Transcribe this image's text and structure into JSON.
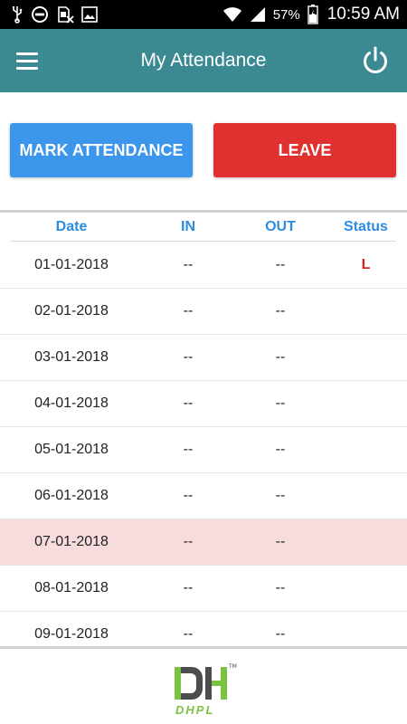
{
  "status_bar": {
    "battery": "57%",
    "time": "10:59 AM",
    "icons": [
      "usb-icon",
      "do-not-disturb-icon",
      "no-sim-icon",
      "image-icon",
      "wifi-icon",
      "signal-icon",
      "battery-icon"
    ]
  },
  "app_bar": {
    "title": "My Attendance",
    "icons": [
      "menu-icon",
      "power-icon"
    ]
  },
  "actions": {
    "mark_label": "MARK ATTENDANCE",
    "leave_label": "LEAVE"
  },
  "table": {
    "headers": {
      "date": "Date",
      "in": "IN",
      "out": "OUT",
      "status": "Status"
    },
    "rows": [
      {
        "date": "01-01-2018",
        "in": "--",
        "out": "--",
        "status": "L"
      },
      {
        "date": "02-01-2018",
        "in": "--",
        "out": "--",
        "status": ""
      },
      {
        "date": "03-01-2018",
        "in": "--",
        "out": "--",
        "status": ""
      },
      {
        "date": "04-01-2018",
        "in": "--",
        "out": "--",
        "status": ""
      },
      {
        "date": "05-01-2018",
        "in": "--",
        "out": "--",
        "status": ""
      },
      {
        "date": "06-01-2018",
        "in": "--",
        "out": "--",
        "status": ""
      },
      {
        "date": "07-01-2018",
        "in": "--",
        "out": "--",
        "status": ""
      },
      {
        "date": "08-01-2018",
        "in": "--",
        "out": "--",
        "status": ""
      },
      {
        "date": "09-01-2018",
        "in": "--",
        "out": "--",
        "status": ""
      }
    ]
  },
  "footer": {
    "logo_text": "DHPL",
    "trademark": "TM"
  },
  "colors": {
    "app_bar": "#3b8a91",
    "mark_button": "#3b96ec",
    "leave_button": "#e03030",
    "header_text": "#2c8de0",
    "highlight_row": "#f8dcdd",
    "status_leave": "#e02020",
    "logo_green": "#7cc242",
    "logo_gray": "#4d4d4d"
  }
}
